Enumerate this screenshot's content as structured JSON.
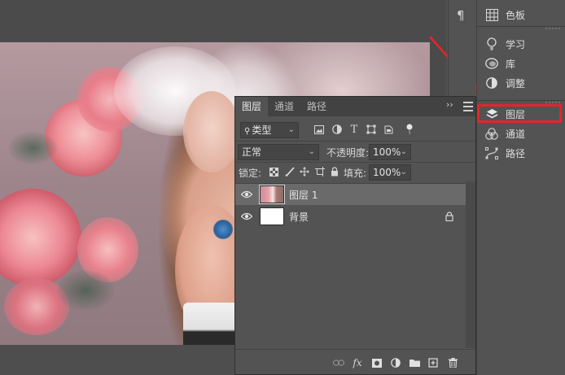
{
  "layers_panel": {
    "tabs": [
      "图层",
      "通道",
      "路径"
    ],
    "filter_kind": "类型",
    "blend_mode": "正常",
    "opacity_label": "不透明度:",
    "opacity_value": "100%",
    "lock_label": "锁定:",
    "fill_label": "填充:",
    "fill_value": "100%",
    "layers": [
      {
        "name": "图层 1",
        "selected": true,
        "visible": true
      },
      {
        "name": "背景",
        "selected": false,
        "visible": true,
        "locked": true
      }
    ],
    "footer_icons": [
      "link-icon",
      "fx-icon",
      "mask-icon",
      "adjustment-icon",
      "folder-icon",
      "new-layer-icon",
      "trash-icon"
    ]
  },
  "dock": {
    "group1": [
      {
        "label": "色板",
        "icon": "swatches-icon"
      }
    ],
    "group2": [
      {
        "label": "学习",
        "icon": "lightbulb-icon"
      },
      {
        "label": "库",
        "icon": "libraries-icon"
      },
      {
        "label": "调整",
        "icon": "adjustments-icon"
      }
    ],
    "group3": [
      {
        "label": "图层",
        "icon": "layers-icon"
      },
      {
        "label": "通道",
        "icon": "channels-icon"
      },
      {
        "label": "路径",
        "icon": "paths-icon"
      }
    ]
  },
  "colors": {
    "ui_bg": "#535353",
    "highlight": "#e8232a",
    "selected_layer": "#6a6a6a"
  }
}
